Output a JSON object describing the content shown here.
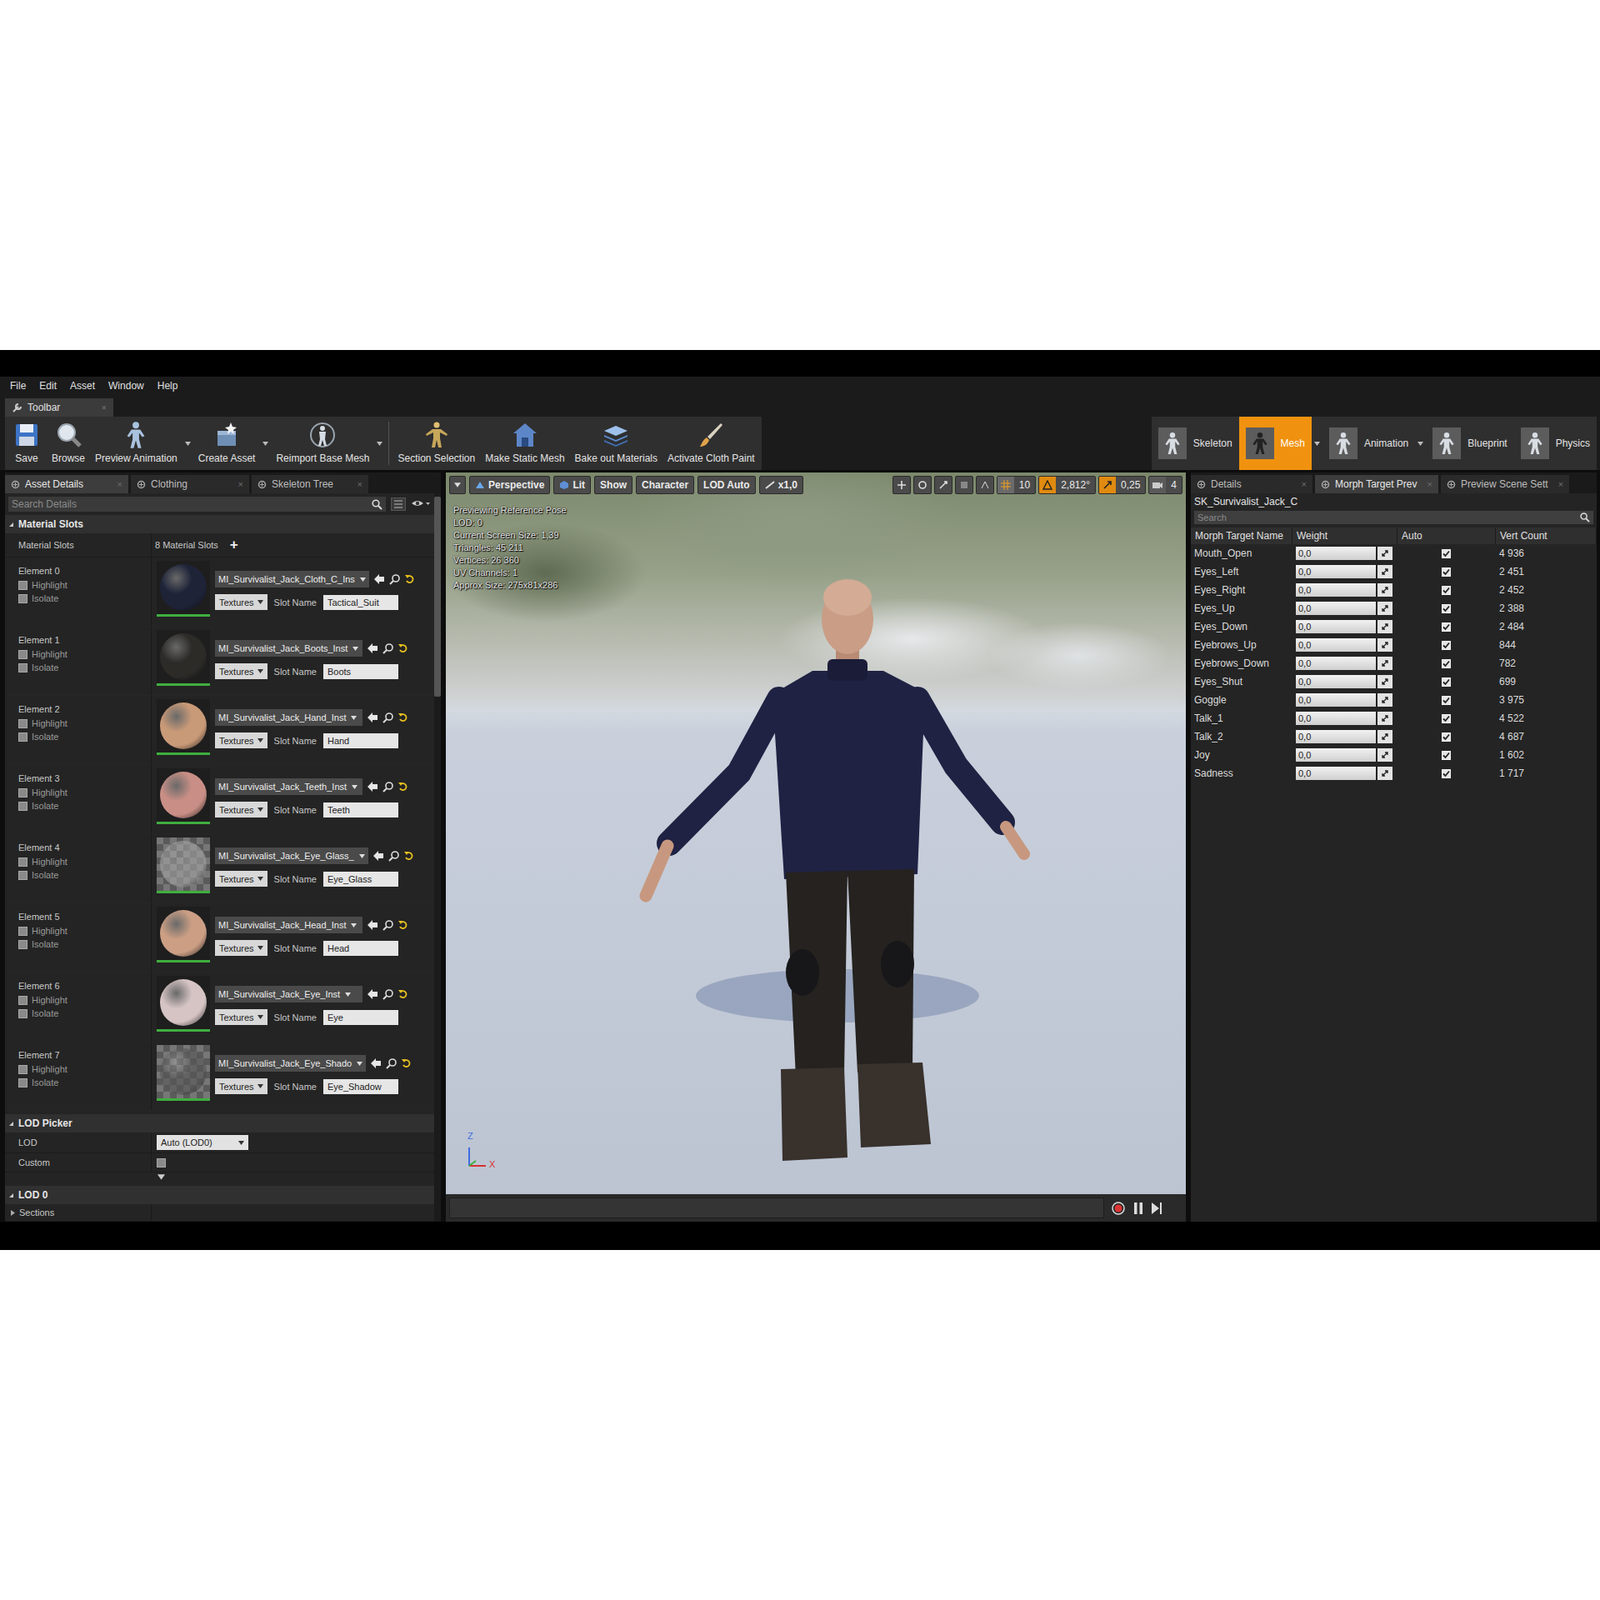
{
  "menu": {
    "items": [
      "File",
      "Edit",
      "Asset",
      "Window",
      "Help"
    ]
  },
  "toolbar_tab": {
    "label": "Toolbar",
    "close": "×"
  },
  "toolbar": {
    "buttons": [
      {
        "label": "Save",
        "dropdown": false
      },
      {
        "label": "Browse",
        "dropdown": false
      },
      {
        "label": "Preview Animation",
        "dropdown": true
      },
      {
        "label": "Create Asset",
        "dropdown": true
      },
      {
        "label": "Reimport Base Mesh",
        "dropdown": true
      },
      {
        "label": "Section Selection",
        "dropdown": false
      },
      {
        "label": "Make Static Mesh",
        "dropdown": false
      },
      {
        "label": "Bake out Materials",
        "dropdown": false
      },
      {
        "label": "Activate Cloth Paint",
        "dropdown": false
      }
    ]
  },
  "modes": [
    {
      "label": "Skeleton",
      "selected": false,
      "dropdown": false
    },
    {
      "label": "Mesh",
      "selected": true,
      "dropdown": true
    },
    {
      "label": "Animation",
      "selected": false,
      "dropdown": true
    },
    {
      "label": "Blueprint",
      "selected": false,
      "dropdown": false
    },
    {
      "label": "Physics",
      "selected": false,
      "dropdown": false
    }
  ],
  "left_panel": {
    "tabs": [
      {
        "label": "Asset Details",
        "selected": true,
        "close": "×"
      },
      {
        "label": "Clothing",
        "selected": false,
        "close": "×"
      },
      {
        "label": "Skeleton Tree",
        "selected": false,
        "close": "×"
      }
    ],
    "search": {
      "placeholder": "Search Details"
    },
    "material_section": {
      "header": "Material Slots",
      "expanded": true,
      "label": "Material Slots",
      "count": "8 Material Slots",
      "add": "+"
    },
    "elements": [
      {
        "label": "Element 0",
        "highlight_label": "Highlight",
        "highlight": false,
        "isolate_label": "Isolate",
        "isolate": false,
        "material": "MI_Survivalist_Jack_Cloth_C_Ins",
        "textures": "Textures",
        "slot_label": "Slot Name",
        "slot_name": "Tactical_Suit",
        "color": "#1e2338"
      },
      {
        "label": "Element 1",
        "highlight_label": "Highlight",
        "highlight": false,
        "isolate_label": "Isolate",
        "isolate": false,
        "material": "MI_Survivalist_Jack_Boots_Inst",
        "textures": "Textures",
        "slot_label": "Slot Name",
        "slot_name": "Boots",
        "color": "#2c2b28"
      },
      {
        "label": "Element 2",
        "highlight_label": "Highlight",
        "highlight": false,
        "isolate_label": "Isolate",
        "isolate": false,
        "material": "MI_Survivalist_Jack_Hand_Inst",
        "textures": "Textures",
        "slot_label": "Slot Name",
        "slot_name": "Hand",
        "color": "#c99a78"
      },
      {
        "label": "Element 3",
        "highlight_label": "Highlight",
        "highlight": false,
        "isolate_label": "Isolate",
        "isolate": false,
        "material": "MI_Survivalist_Jack_Teeth_Inst",
        "textures": "Textures",
        "slot_label": "Slot Name",
        "slot_name": "Teeth",
        "color": "#c98f86"
      },
      {
        "label": "Element 4",
        "highlight_label": "Highlight",
        "highlight": false,
        "isolate_label": "Isolate",
        "isolate": false,
        "material": "MI_Survivalist_Jack_Eye_Glass_",
        "textures": "Textures",
        "slot_label": "Slot Name",
        "slot_name": "Eye_Glass",
        "color": "#a3a3a3"
      },
      {
        "label": "Element 5",
        "highlight_label": "Highlight",
        "highlight": false,
        "isolate_label": "Isolate",
        "isolate": false,
        "material": "MI_Survivalist_Jack_Head_Inst",
        "textures": "Textures",
        "slot_label": "Slot Name",
        "slot_name": "Head",
        "color": "#cc9f85"
      },
      {
        "label": "Element 6",
        "highlight_label": "Highlight",
        "highlight": false,
        "isolate_label": "Isolate",
        "isolate": false,
        "material": "MI_Survivalist_Jack_Eye_Inst",
        "textures": "Textures",
        "slot_label": "Slot Name",
        "slot_name": "Eye",
        "color": "#d6c4c4"
      },
      {
        "label": "Element 7",
        "highlight_label": "Highlight",
        "highlight": false,
        "isolate_label": "Isolate",
        "isolate": false,
        "material": "MI_Survivalist_Jack_Eye_Shado",
        "textures": "Textures",
        "slot_label": "Slot Name",
        "slot_name": "Eye_Shadow",
        "color": "#555555"
      }
    ],
    "lod_picker": {
      "header": "LOD Picker",
      "expanded": true,
      "lod_label": "LOD",
      "lod_value": "Auto (LOD0)",
      "custom_label": "Custom",
      "custom_checked": false
    },
    "lod0": {
      "header": "LOD 0",
      "expanded": true,
      "sections": "Sections",
      "sections_expanded": false
    }
  },
  "viewport": {
    "toolbar": {
      "buttons": [
        "Perspective",
        "Lit",
        "Show",
        "Character",
        "LOD Auto",
        "x1,0"
      ],
      "grid": "10",
      "rotation": "2,812°",
      "scale": "0,25",
      "camera_speed": "4"
    },
    "info": [
      "Previewing Reference Pose",
      "LOD: 0",
      "Current Screen Size: 1,39",
      "Triangles: 45 211",
      "Vertices: 26 360",
      "UV Channels: 1",
      "Approx Size: 275x81x286"
    ],
    "axis": {
      "z": "Z",
      "x": "X"
    }
  },
  "right_panel": {
    "tabs": [
      {
        "label": "Details",
        "selected": false,
        "close": "×"
      },
      {
        "label": "Morph Target Prev",
        "selected": true,
        "close": "×"
      },
      {
        "label": "Preview Scene Sett",
        "selected": false,
        "close": "×"
      }
    ],
    "asset": "SK_Survivalist_Jack_C",
    "search": {
      "placeholder": "Search"
    },
    "columns": [
      "Morph Target Name",
      "Weight",
      "Auto",
      "Vert Count"
    ],
    "rows": [
      {
        "name": "Mouth_Open",
        "weight": "0,0",
        "level": 0,
        "auto": true,
        "verts": "4 936"
      },
      {
        "name": "Eyes_Left",
        "weight": "0,0",
        "level": 0,
        "auto": true,
        "verts": "2 451"
      },
      {
        "name": "Eyes_Right",
        "weight": "0,0",
        "level": 0,
        "auto": true,
        "verts": "2 452"
      },
      {
        "name": "Eyes_Up",
        "weight": "0,0",
        "level": 0,
        "auto": true,
        "verts": "2 388"
      },
      {
        "name": "Eyes_Down",
        "weight": "0,0",
        "level": 0,
        "auto": true,
        "verts": "2 484"
      },
      {
        "name": "Eyebrows_Up",
        "weight": "0,0",
        "level": 0,
        "auto": true,
        "verts": "844"
      },
      {
        "name": "Eyebrows_Down",
        "weight": "0,0",
        "level": 0,
        "auto": true,
        "verts": "782"
      },
      {
        "name": "Eyes_Shut",
        "weight": "0,0",
        "level": 0,
        "auto": true,
        "verts": "699"
      },
      {
        "name": "Goggle",
        "weight": "0,0",
        "level": 0,
        "auto": true,
        "verts": "3 975"
      },
      {
        "name": "Talk_1",
        "weight": "0,0",
        "level": 0,
        "auto": true,
        "verts": "4 522"
      },
      {
        "name": "Talk_2",
        "weight": "0,0",
        "level": 0,
        "auto": true,
        "verts": "4 687"
      },
      {
        "name": "Joy",
        "weight": "0,0",
        "level": 0,
        "auto": true,
        "verts": "1 602"
      },
      {
        "name": "Sadness",
        "weight": "0,0",
        "level": 0,
        "auto": true,
        "verts": "1 717"
      }
    ]
  }
}
